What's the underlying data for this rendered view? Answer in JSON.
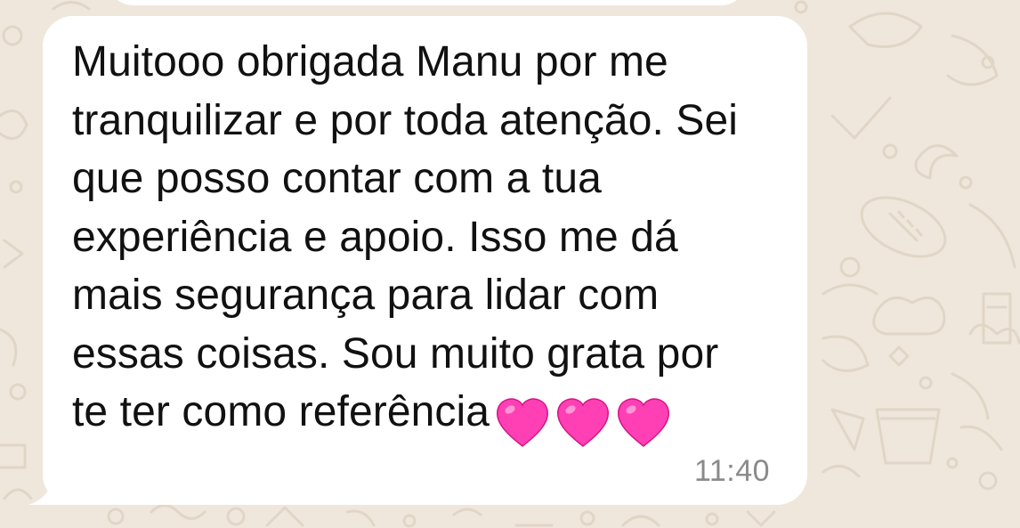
{
  "colors": {
    "wallpaper": "#efe7dc",
    "doodle": "#e1d6c6",
    "bubble": "#ffffff",
    "text": "#111111",
    "timestamp": "#8a8a8a",
    "heart": "#ff3fb4"
  },
  "chat": {
    "message": {
      "text": "Muitooo obrigada Manu por me\ntranquilizar e por toda atenção. Sei\nque posso contar com a tua\nexperiência e apoio. Isso me dá\nmais segurança para lidar com\nessas coisas. Sou muito grata por\nte ter como referência",
      "emoji": [
        "pink-heart-icon",
        "pink-heart-icon",
        "pink-heart-icon"
      ],
      "time": "11:40"
    }
  }
}
